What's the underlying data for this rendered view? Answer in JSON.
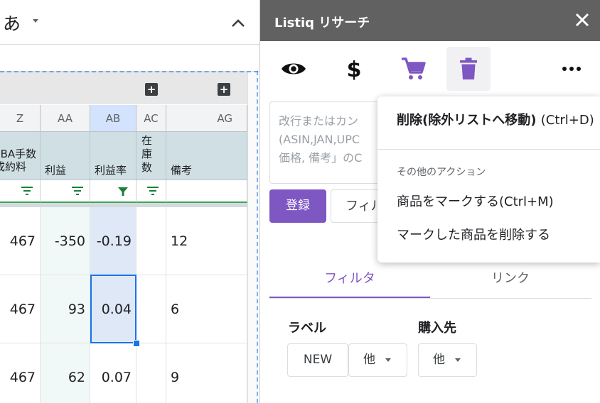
{
  "toolbar": {
    "font_name": "あ"
  },
  "sheet": {
    "columns": [
      "Z",
      "AA",
      "AB",
      "AC",
      "AG"
    ],
    "headers": {
      "z": [
        "FBA手数",
        "成約料"
      ],
      "aa": "利益",
      "ab": "利益率",
      "ac": [
        "在",
        "庫",
        "数"
      ],
      "ag": "備考"
    },
    "group_button": "+",
    "rows": [
      {
        "z": "467",
        "aa": "-350",
        "ab": "-0.19",
        "ac": "",
        "ag": "12"
      },
      {
        "z": "467",
        "aa": "93",
        "ab": "0.04",
        "ac": "",
        "ag": "6"
      },
      {
        "z": "467",
        "aa": "62",
        "ab": "0.07",
        "ac": "",
        "ag": "9"
      }
    ]
  },
  "panel": {
    "title": "Listiq リサーチ",
    "close": "✕",
    "toolbar_icons": [
      "eye-icon",
      "dollar-icon",
      "cart-icon",
      "trash-icon",
      "more-icon"
    ],
    "input_placeholder_lines": [
      "改行またはカン",
      "(ASIN,JAN,UPC",
      "価格, 備考」のC"
    ],
    "register_label": "登録",
    "filter_button_label": "フィル",
    "tabs": {
      "filter": "フィルタ",
      "link": "リンク"
    },
    "filters": {
      "label_title": "ラベル",
      "label_new": "NEW",
      "label_other": "他",
      "supplier_title": "購入先",
      "supplier_other": "他"
    }
  },
  "menu": {
    "delete_label": "削除(除外リストへ移動)",
    "delete_shortcut": "(Ctrl+D)",
    "section_title": "その他のアクション",
    "mark_item": "商品をマークする(Ctrl+M)",
    "delete_marked": "マークした商品を削除する"
  },
  "colors": {
    "accent": "#7e57c2",
    "header_bg": "#616161",
    "selection": "#1a73e8",
    "filter_green": "#188038"
  }
}
